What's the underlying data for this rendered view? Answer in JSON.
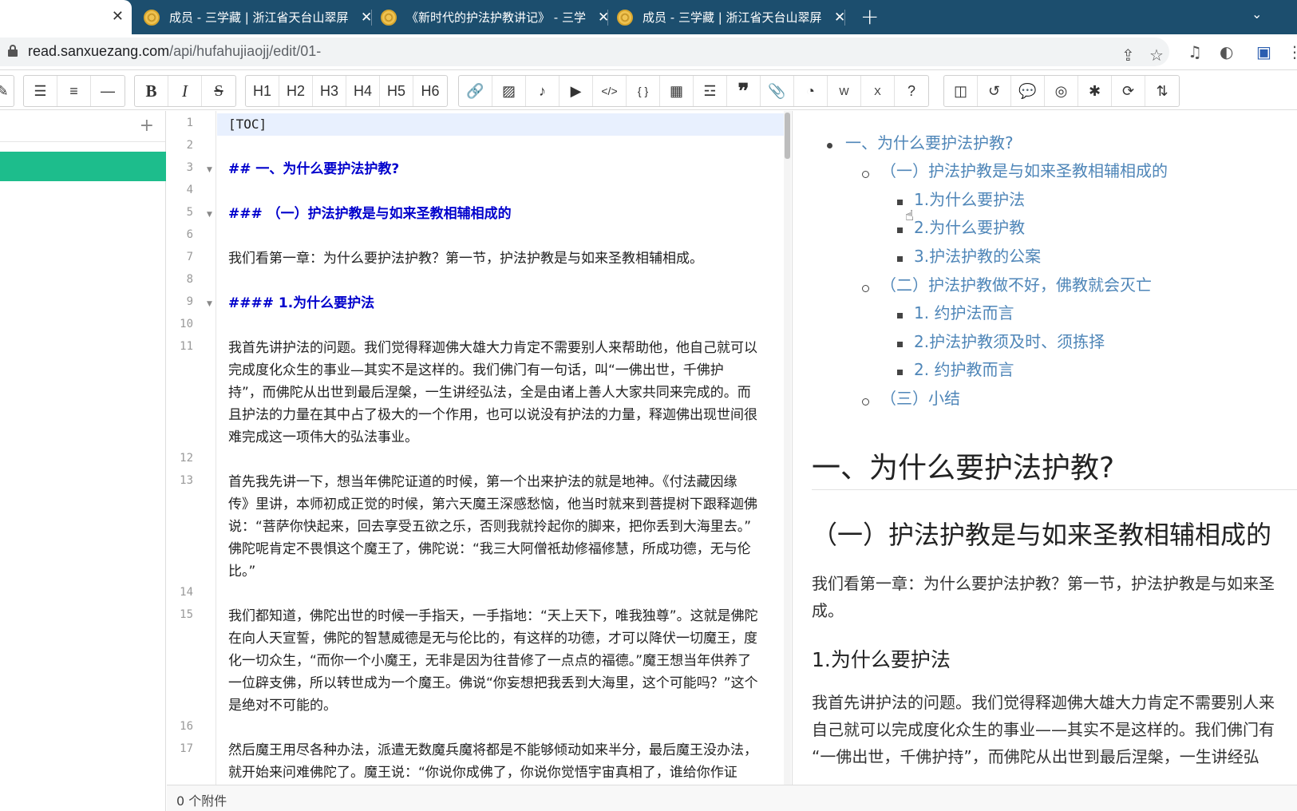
{
  "browser": {
    "tabs": [
      {
        "title": "成员 - 三学藏 | 浙江省天台山翠屏"
      },
      {
        "title": "《新时代的护法护教讲记》 - 三学"
      },
      {
        "title": "成员 - 三学藏 | 浙江省天台山翠屏"
      }
    ],
    "url_host": "read.sanxuezang.com",
    "url_path": "/api/hufahujiaojj/edit/01-"
  },
  "toolbar": {
    "headings": [
      "H1",
      "H2",
      "H3",
      "H4",
      "H5",
      "H6"
    ]
  },
  "editor": {
    "lines": [
      {
        "num": "1",
        "text": "[TOC]"
      },
      {
        "num": "2",
        "text": ""
      },
      {
        "num": "3",
        "text": "## 一、为什么要护法护教?"
      },
      {
        "num": "4",
        "text": ""
      },
      {
        "num": "5",
        "text": "### （一）护法护教是与如来圣教相辅相成的"
      },
      {
        "num": "6",
        "text": ""
      },
      {
        "num": "7",
        "text": "我们看第一章：为什么要护法护教？第一节，护法护教是与如来圣教相辅相成。"
      },
      {
        "num": "8",
        "text": ""
      },
      {
        "num": "9",
        "text": "#### 1.为什么要护法"
      },
      {
        "num": "10",
        "text": ""
      },
      {
        "num": "11",
        "lines": [
          "我首先讲护法的问题。我们觉得释迦佛大雄大力肯定不需要别人来帮助他，他自己就可以",
          "完成度化众生的事业—其实不是这样的。我们佛门有一句话，叫“一佛出世，千佛护",
          "持”，而佛陀从出世到最后涅槃，一生讲经弘法，全是由诸上善人大家共同来完成的。而",
          "且护法的力量在其中占了极大的一个作用，也可以说没有护法的力量，释迦佛出现世间很",
          "难完成这一项伟大的弘法事业。"
        ]
      },
      {
        "num": "12",
        "text": ""
      },
      {
        "num": "13",
        "lines": [
          "首先我先讲一下，想当年佛陀证道的时候，第一个出来护法的就是地神。《付法藏因缘",
          "传》里讲，本师初成正觉的时候，第六天魔王深感愁恼，他当时就来到菩提树下跟释迦佛",
          "说：“菩萨你快起来，回去享受五欲之乐，否则我就拎起你的脚来，把你丢到大海里去。”",
          "佛陀呢肯定不畏惧这个魔王了，佛陀说：“我三大阿僧祇劫修福修慧，所成功德，无与伦",
          "比。”"
        ]
      },
      {
        "num": "14",
        "text": ""
      },
      {
        "num": "15",
        "lines": [
          "我们都知道，佛陀出世的时候一手指天，一手指地：“天上天下，唯我独尊”。这就是佛陀",
          "在向人天宣誓，佛陀的智慧威德是无与伦比的，有这样的功德，才可以降伏一切魔王，度",
          "化一切众生，“而你一个小魔王，无非是因为往昔修了一点点的福德。”魔王想当年供养了",
          "一位辟支佛，所以转世成为一个魔王。佛说“你妄想把我丢到大海里，这个可能吗？”这个",
          "是绝对不可能的。"
        ]
      },
      {
        "num": "16",
        "text": ""
      },
      {
        "num": "17",
        "lines": [
          "然后魔王用尽各种办法，派遣无数魔兵魔将都是不能够倾动如来半分，最后魔王没办法，",
          "就开始来问难佛陀了。魔王说：“你说你成佛了，你说你觉悟宇宙真相了，谁给你作证"
        ]
      }
    ]
  },
  "status": {
    "attachments": "0 个附件"
  },
  "preview": {
    "toc": [
      {
        "level": 1,
        "text": "一、为什么要护法护教?"
      },
      {
        "level": 2,
        "text": "（一）护法护教是与如来圣教相辅相成的"
      },
      {
        "level": 3,
        "text": "1.为什么要护法"
      },
      {
        "level": 3,
        "text": "2.为什么要护教"
      },
      {
        "level": 3,
        "text": "3.护法护教的公案"
      },
      {
        "level": 2,
        "text": "（二）护法护教做不好，佛教就会灭亡"
      },
      {
        "level": 3,
        "text": "1. 约护法而言"
      },
      {
        "level": 3,
        "text": "2.护法护教须及时、须拣择"
      },
      {
        "level": 3,
        "text": "2. 约护教而言"
      },
      {
        "level": 2,
        "text": "（三）小结"
      }
    ],
    "h1": "一、为什么要护法护教?",
    "h2": "（一）护法护教是与如来圣教相辅相成的",
    "p1_line1": "我们看第一章：为什么要护法护教？第一节，护法护教是与如来圣",
    "p1_line2": "成。",
    "h4": "1.为什么要护法",
    "p2_line1": "我首先讲护法的问题。我们觉得释迦佛大雄大力肯定不需要别人来",
    "p2_line2": "自己就可以完成度化众生的事业——其实不是这样的。我们佛门有",
    "p2_line3": "“一佛出世，千佛护持”，而佛陀从出世到最后涅槃，一生讲经弘"
  }
}
